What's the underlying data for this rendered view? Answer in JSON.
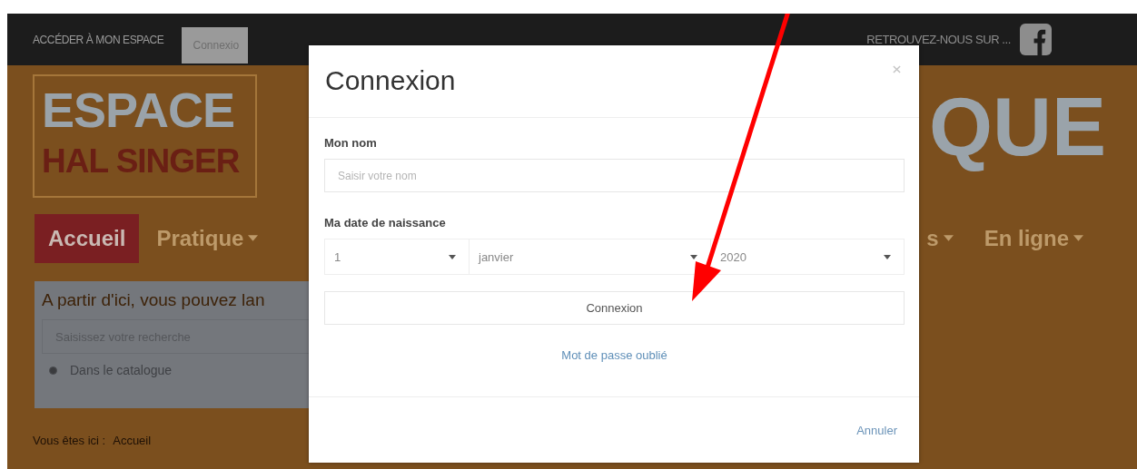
{
  "top_bar": {
    "account_label": "ACCÉDER À MON ESPACE",
    "login_tab": "Connexio",
    "follow_text": "RETROUVEZ-NOUS SUR ..."
  },
  "logo": {
    "line_1": "ESPACE",
    "line_2": "HAL SINGER"
  },
  "banner_title": "QUE",
  "nav": [
    {
      "label": "Accueil",
      "selected": true,
      "dropdown": false
    },
    {
      "label": "Pratique",
      "selected": false,
      "dropdown": true
    },
    {
      "label": "s",
      "selected": false,
      "dropdown": true
    },
    {
      "label": "En ligne",
      "selected": false,
      "dropdown": true
    }
  ],
  "search_panel": {
    "heading": "A partir d'ici, vous pouvez lan",
    "placeholder": "Saisissez votre recherche",
    "option": {
      "label": "Dans le catalogue",
      "selected": true
    }
  },
  "breadcrumb": {
    "prefix": "Vous êtes ici :",
    "current": "Accueil"
  },
  "modal": {
    "title": "Connexion",
    "name_label": "Mon nom",
    "name_placeholder": "Saisir votre nom",
    "birth_label": "Ma date de naissance",
    "date_selects": [
      {
        "value": "1"
      },
      {
        "value": "janvier"
      },
      {
        "value": "2020"
      }
    ],
    "submit": "Connexion",
    "forgot_link": "Mot de passe oublié",
    "cancel": "Annuler"
  }
}
